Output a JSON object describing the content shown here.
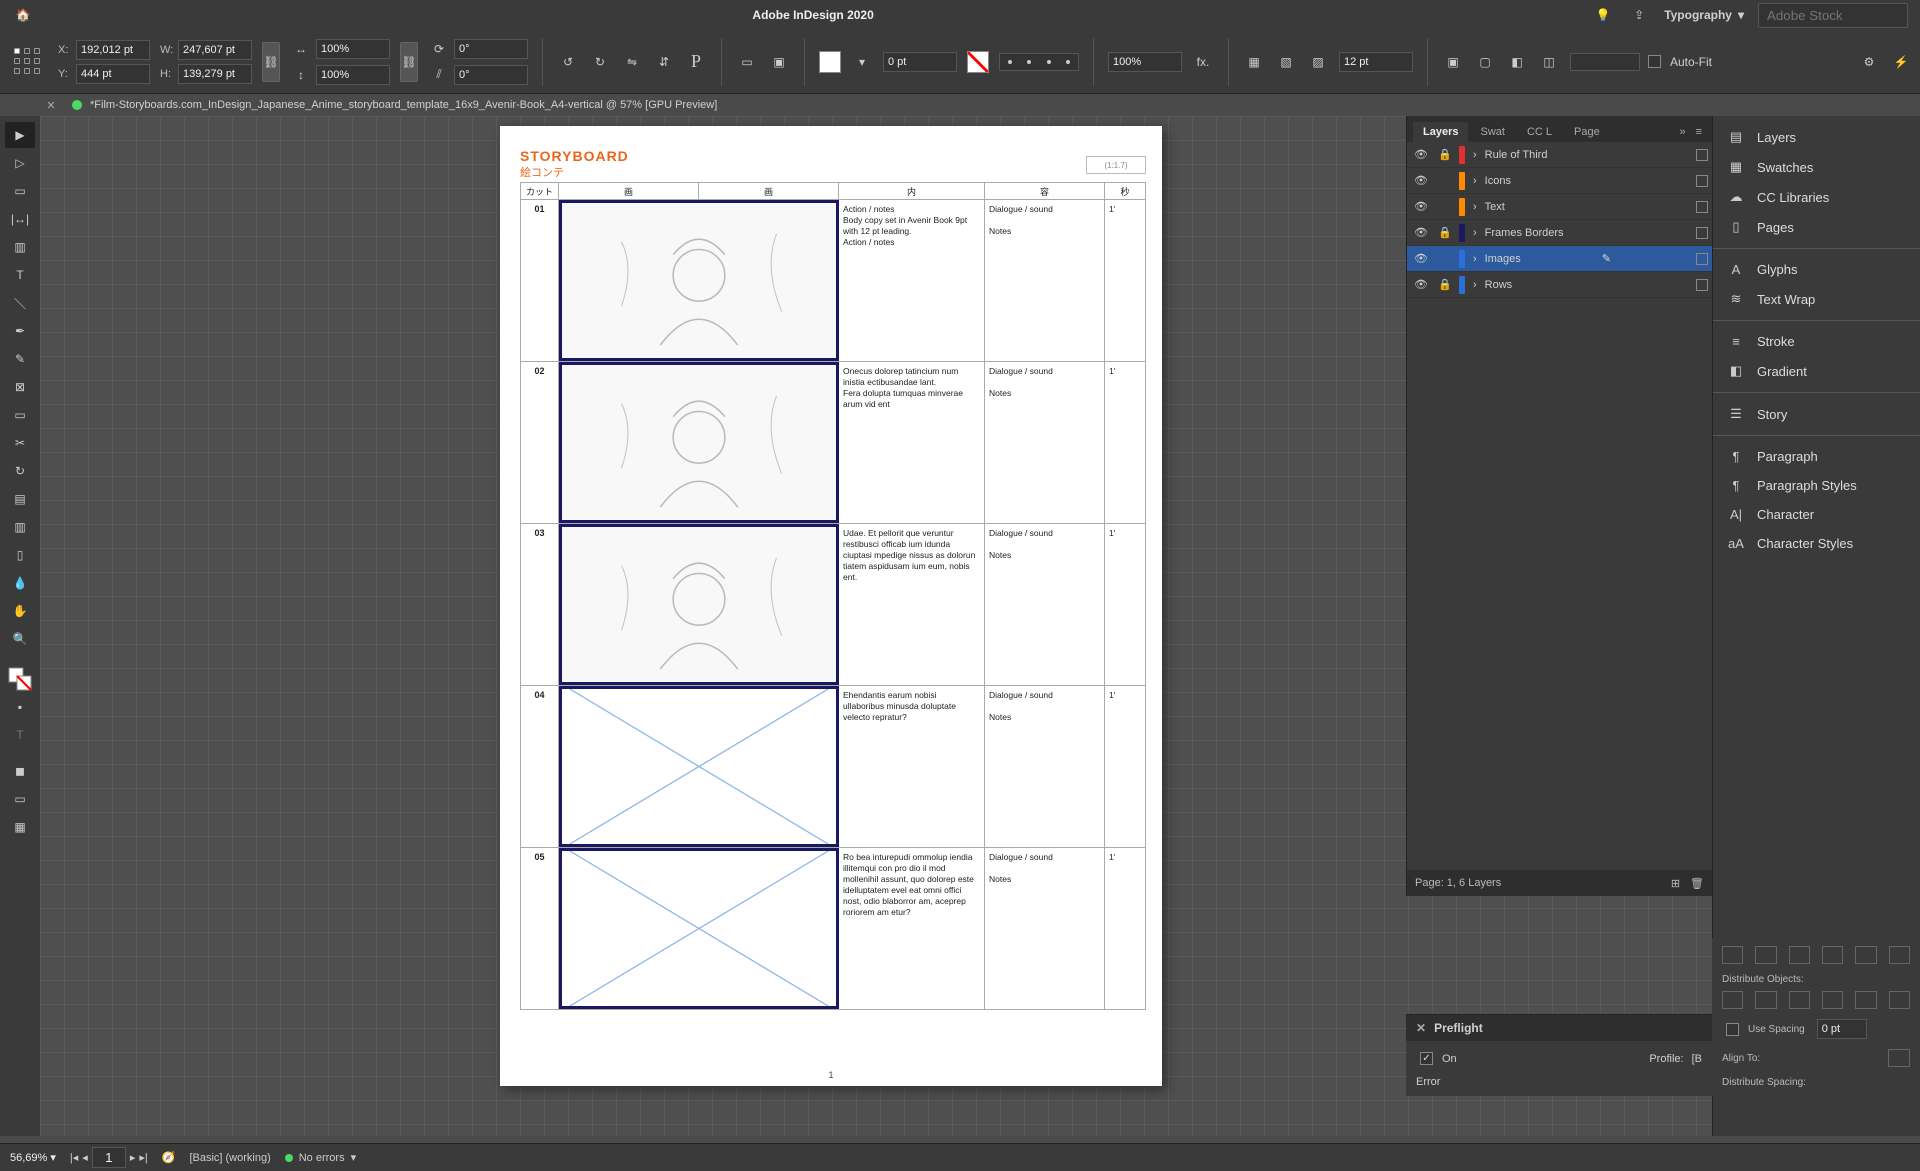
{
  "app": {
    "title": "Adobe InDesign 2020",
    "workspace": "Typography",
    "search_placeholder": "Adobe Stock"
  },
  "doc": {
    "tab_title": "*Film-Storyboards.com_InDesign_Japanese_Anime_storyboard_template_16x9_Avenir-Book_A4-vertical @ 57% [GPU Preview]"
  },
  "transform": {
    "x": "192,012 pt",
    "y": "444 pt",
    "w": "247,607 pt",
    "h": "139,279 pt",
    "scale_x": "100%",
    "scale_y": "100%",
    "rotate": "0°",
    "shear": "0°",
    "stroke_weight": "0 pt",
    "corner": "12 pt",
    "opacity": "100%",
    "autofit": "Auto-Fit"
  },
  "page": {
    "heading": "STORYBOARD",
    "subheading": "絵コンテ",
    "corner": "(1:1.7)",
    "cols": {
      "cut": "カット",
      "pic1": "画",
      "pic2": "画",
      "content": "内",
      "dialog": "容",
      "sec": "秒"
    },
    "rows": [
      {
        "num": "01",
        "action": "Action / notes\nBody copy set in Avenir Book 9pt with 12 pt leading.\nAction / notes",
        "dialog": "Dialogue / sound\n\nNotes",
        "sec": "1'",
        "img": "sketch"
      },
      {
        "num": "02",
        "action": "Onecus dolorep tatincium num inistia ectibusandae lant.\nFera dolupta tumquas minverae arum vid ent",
        "dialog": "Dialogue / sound\n\nNotes",
        "sec": "1'",
        "img": "sketch"
      },
      {
        "num": "03",
        "action": "Udae. Et pellorit que veruntur restibusci officab ium idunda ciuptasi mpedige nissus as dolorun tiatem aspidusam ium eum, nobis ent.",
        "dialog": "Dialogue / sound\n\nNotes",
        "sec": "1'",
        "img": "sketch"
      },
      {
        "num": "04",
        "action": "Ehendantis earum nobisi ullaboribus minusda doluptate velecto repratur?",
        "dialog": "Dialogue / sound\n\nNotes",
        "sec": "1'",
        "img": "empty"
      },
      {
        "num": "05",
        "action": "Ro bea inturepudi ommolup iendia illitemqui con pro dio il mod mollenihil assunt, quo dolorep este idelluptatem evel eat omni offici nost, odio blaborror am, aceprep roriorem am etur?",
        "dialog": "Dialogue / sound\n\nNotes",
        "sec": "1'",
        "img": "empty"
      }
    ],
    "pagenum": "1"
  },
  "layers": {
    "tabs": [
      "Layers",
      "Swat",
      "CC L",
      "Page"
    ],
    "items": [
      {
        "name": "Rule of Third",
        "color": "#e03030",
        "locked": true
      },
      {
        "name": "Icons",
        "color": "#ff8a00",
        "locked": false
      },
      {
        "name": "Text",
        "color": "#ff8a00",
        "locked": false
      },
      {
        "name": "Frames Borders",
        "color": "#1a1860",
        "locked": true
      },
      {
        "name": "Images",
        "color": "#2d6fd8",
        "locked": false,
        "selected": true,
        "pen": true
      },
      {
        "name": "Rows",
        "color": "#2d6fd8",
        "locked": true
      }
    ],
    "footer": "Page: 1, 6 Layers"
  },
  "dock": [
    {
      "icon": "layers",
      "label": "Layers"
    },
    {
      "icon": "swatches",
      "label": "Swatches"
    },
    {
      "icon": "cc",
      "label": "CC Libraries"
    },
    {
      "icon": "pages",
      "label": "Pages"
    },
    {
      "div": true
    },
    {
      "icon": "glyphs",
      "label": "Glyphs"
    },
    {
      "icon": "wrap",
      "label": "Text Wrap"
    },
    {
      "div": true
    },
    {
      "icon": "stroke",
      "label": "Stroke"
    },
    {
      "icon": "gradient",
      "label": "Gradient"
    },
    {
      "div": true
    },
    {
      "icon": "story",
      "label": "Story"
    },
    {
      "div": true
    },
    {
      "icon": "para",
      "label": "Paragraph"
    },
    {
      "icon": "pstyles",
      "label": "Paragraph Styles"
    },
    {
      "icon": "char",
      "label": "Character"
    },
    {
      "icon": "cstyles",
      "label": "Character Styles"
    }
  ],
  "preflight": {
    "title": "Preflight",
    "on": "On",
    "profile_lbl": "Profile:",
    "profile": "[B",
    "error": "Error"
  },
  "align": {
    "distribute_objects": "Distribute Objects:",
    "use_spacing": "Use Spacing",
    "spacing": "0 pt",
    "align_to": "Align To:",
    "distribute_spacing": "Distribute Spacing:"
  },
  "status": {
    "zoom": "56,69%",
    "page": "1",
    "style": "[Basic] (working)",
    "errors": "No errors"
  }
}
